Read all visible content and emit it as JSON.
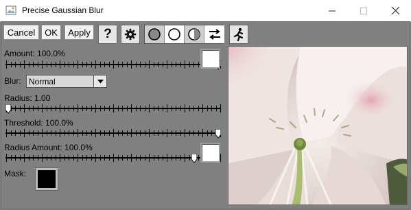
{
  "window": {
    "title": "Precise Gaussian Blur"
  },
  "window_controls": {
    "minimize_icon": "minimize-icon",
    "maximize_icon": "maximize-icon",
    "close_icon": "close-icon"
  },
  "toolbar": {
    "cancel_label": "Cancel",
    "ok_label": "OK",
    "apply_label": "Apply",
    "help_label": "?",
    "icons": [
      "gear-icon",
      "mode-dark-circle-icon",
      "mode-white-circle-icon",
      "mode-half-circle-icon",
      "swap-arrows-icon",
      "running-man-icon"
    ]
  },
  "controls": {
    "amount_label": "Amount: 100.0%",
    "amount_value": 1.0,
    "blur_label": "Blur:",
    "blur_value": "Normal",
    "radius_label": "Radius: 1.00",
    "radius_value": 0.0,
    "threshold_label": "Threshold: 100.0%",
    "threshold_value": 1.0,
    "radius_amount_label": "Radius Amount: 100.0%",
    "radius_amount_value": 0.885,
    "mask_label": "Mask:"
  },
  "colors": {
    "panel": "#808080",
    "mask": "#000000",
    "swatch": "#ffffff"
  }
}
